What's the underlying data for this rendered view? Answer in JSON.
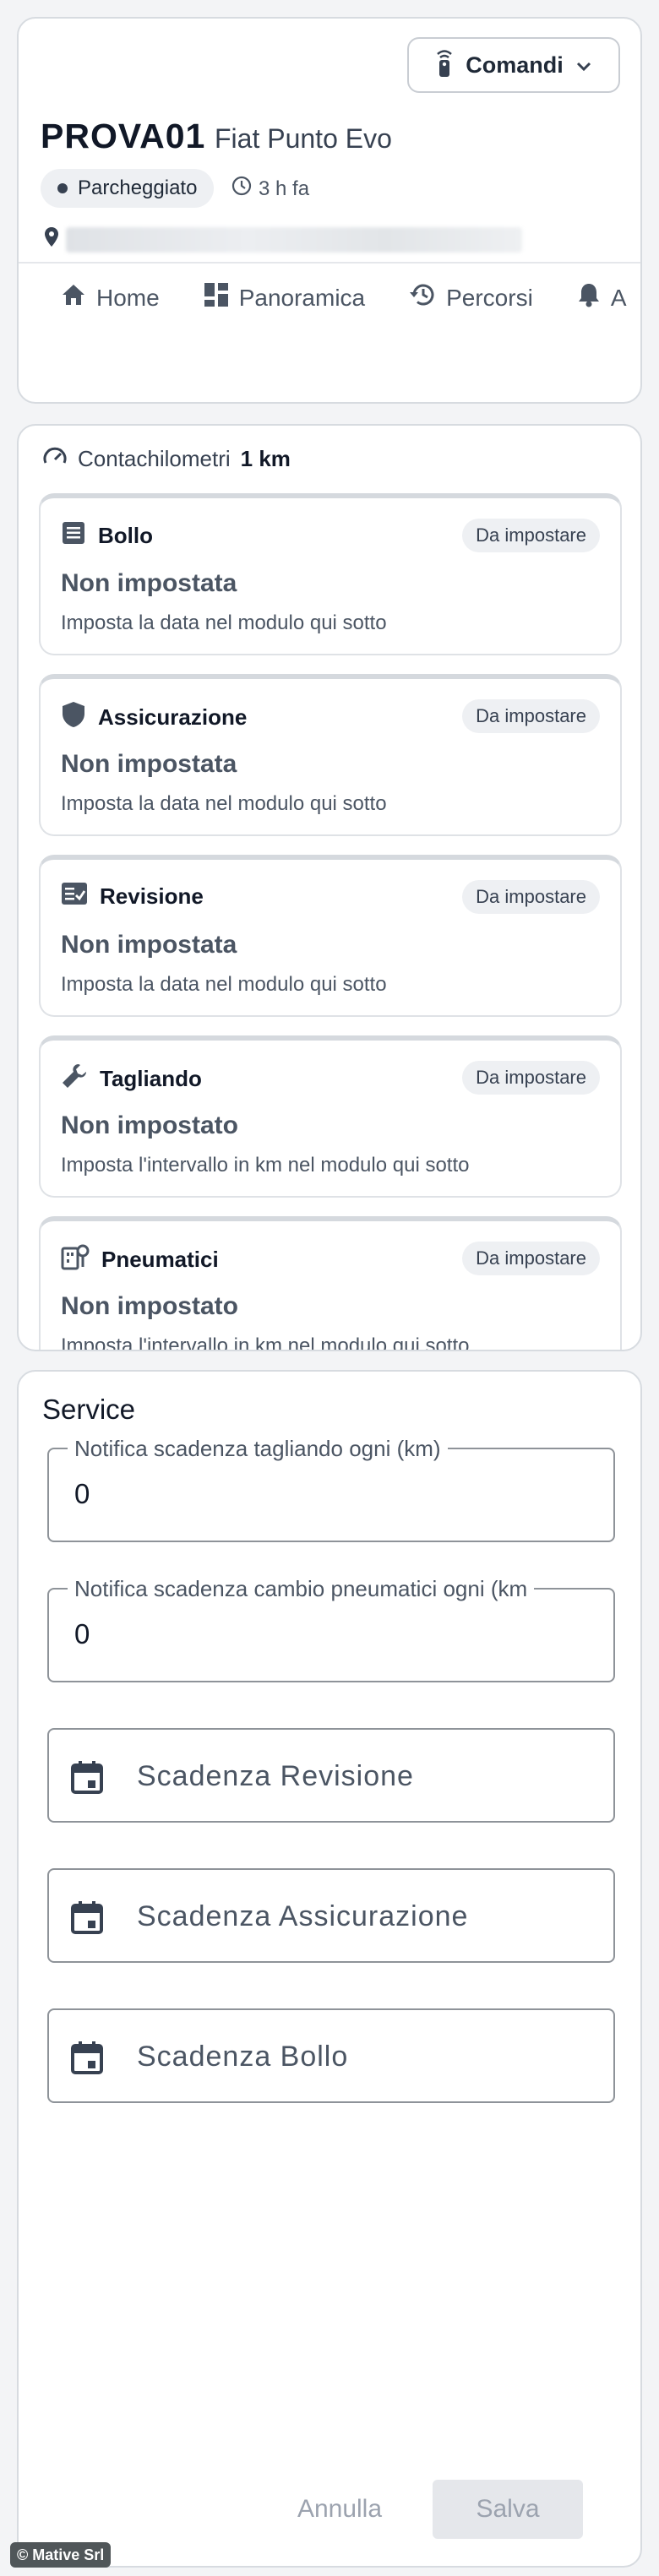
{
  "vehicle": {
    "commands_label": "Comandi",
    "plate": "PROVA01",
    "model": "Fiat Punto Evo",
    "status": "Parcheggiato",
    "last_update": "3 h fa",
    "tabs": [
      {
        "label": "Home",
        "icon": "home-icon"
      },
      {
        "label": "Panoramica",
        "icon": "dashboard-icon"
      },
      {
        "label": "Percorsi",
        "icon": "history-icon"
      },
      {
        "label": "A",
        "icon": "bell-icon"
      }
    ]
  },
  "odometer": {
    "label": "Contachilometri",
    "value": "1 km"
  },
  "deadlines": [
    {
      "title": "Bollo",
      "badge": "Da impostare",
      "value": "Non impostata",
      "hint": "Imposta la data nel modulo qui sotto",
      "icon": "document-icon"
    },
    {
      "title": "Assicurazione",
      "badge": "Da impostare",
      "value": "Non impostata",
      "hint": "Imposta la data nel modulo qui sotto",
      "icon": "shield-icon"
    },
    {
      "title": "Revisione",
      "badge": "Da impostare",
      "value": "Non impostata",
      "hint": "Imposta la data nel modulo qui sotto",
      "icon": "checklist-icon"
    },
    {
      "title": "Tagliando",
      "badge": "Da impostare",
      "value": "Non impostato",
      "hint": "Imposta l'intervallo in km nel modulo qui sotto",
      "icon": "wrench-icon"
    },
    {
      "title": "Pneumatici",
      "badge": "Da impostare",
      "value": "Non impostato",
      "hint": "Imposta l'intervallo in km nel modulo qui sotto",
      "icon": "tire-service-icon"
    }
  ],
  "service": {
    "title": "Service",
    "service_interval_label": "Notifica scadenza tagliando ogni (km)",
    "service_interval_value": "0",
    "tire_interval_label": "Notifica scadenza cambio pneumatici ogni (km",
    "tire_interval_value": "0",
    "revision_placeholder": "Scadenza Revisione",
    "insurance_placeholder": "Scadenza Assicurazione",
    "tax_placeholder": "Scadenza Bollo",
    "cancel_label": "Annulla",
    "save_label": "Salva"
  },
  "footer": {
    "copyright": "© Mative Srl"
  }
}
